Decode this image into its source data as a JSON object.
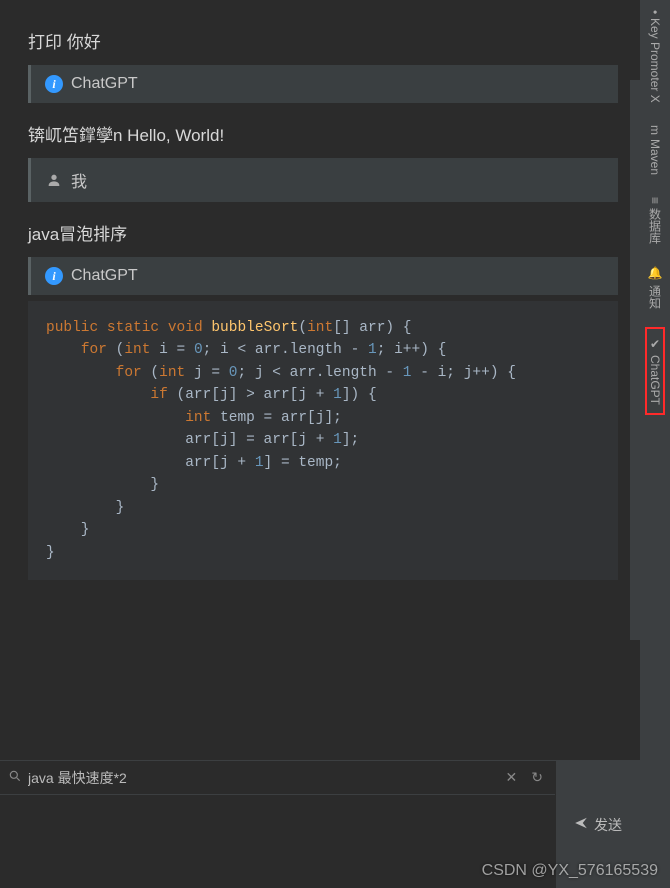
{
  "chat": {
    "messages": [
      {
        "role": "user_text",
        "text": "打印 你好"
      },
      {
        "role": "assistant_header",
        "name": "ChatGPT"
      },
      {
        "role": "assistant_text",
        "text": "锛屼笘鐣孿n Hello, World!"
      },
      {
        "role": "user_header",
        "name": "我"
      },
      {
        "role": "user_text",
        "text": "java冒泡排序"
      },
      {
        "role": "assistant_header",
        "name": "ChatGPT"
      }
    ],
    "code": {
      "tokens": [
        [
          "",
          "public",
          " ",
          "static",
          " ",
          "void",
          " ",
          [
            "fn",
            "bubbleSort"
          ],
          "(",
          "int",
          "[] arr) {"
        ],
        [
          "    ",
          "for",
          " (",
          "int",
          " i = ",
          [
            "num",
            "0"
          ],
          "; i < arr.length - ",
          [
            "num",
            "1"
          ],
          "; i++) {"
        ],
        [
          "        ",
          "for",
          " (",
          "int",
          " j = ",
          [
            "num",
            "0"
          ],
          "; j < arr.length - ",
          [
            "num",
            "1"
          ],
          " - i; j++) {"
        ],
        [
          "            ",
          "if",
          " (arr[j] > arr[j + ",
          [
            "num",
            "1"
          ],
          "]) {"
        ],
        [
          "                ",
          "int",
          " temp = arr[j];"
        ],
        [
          "                arr[j] = arr[j + ",
          [
            "num",
            "1"
          ],
          "];"
        ],
        [
          "                arr[j + ",
          [
            "num",
            "1"
          ],
          "] = temp;"
        ],
        [
          "            }"
        ],
        [
          "        }"
        ],
        [
          "    }"
        ],
        [
          "}"
        ]
      ]
    }
  },
  "input": {
    "value": "java 最快速度*2",
    "send_label": "发送"
  },
  "sidebar": {
    "tabs": [
      {
        "id": "key-promoter",
        "label": "Key Promoter X",
        "icon": "•"
      },
      {
        "id": "maven",
        "label": "Maven",
        "icon": "m"
      },
      {
        "id": "database",
        "label": "数据库",
        "icon": "≡"
      },
      {
        "id": "notifications",
        "label": "通知",
        "icon": "🔔"
      },
      {
        "id": "chatgpt",
        "label": "ChatGPT",
        "icon": "✔",
        "highlighted": true
      }
    ]
  },
  "watermark": "CSDN @YX_576165539"
}
